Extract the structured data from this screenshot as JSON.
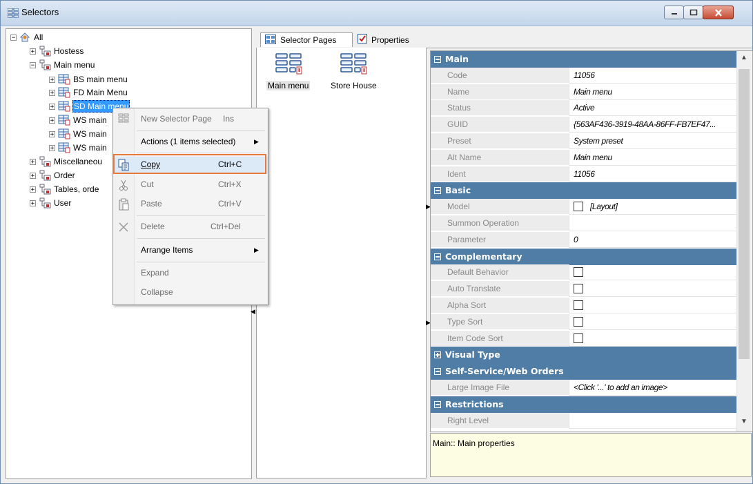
{
  "window": {
    "title": "Selectors"
  },
  "tree": {
    "root": "All",
    "items": [
      {
        "label": "Hostess",
        "expander": "+"
      },
      {
        "label": "Main menu",
        "expander": "−"
      },
      {
        "label": "BS main menu",
        "expander": "+"
      },
      {
        "label": "FD Main Menu",
        "expander": "+"
      },
      {
        "label": "SD Main menu",
        "expander": "+"
      },
      {
        "label": "WS main",
        "expander": "+"
      },
      {
        "label": "WS main",
        "expander": "+"
      },
      {
        "label": "WS main",
        "expander": "+"
      },
      {
        "label": "Miscellaneou",
        "expander": "+"
      },
      {
        "label": "Order",
        "expander": "+"
      },
      {
        "label": "Tables, orde",
        "expander": "+"
      },
      {
        "label": "User",
        "expander": "+"
      }
    ]
  },
  "tabs": {
    "selector_pages": "Selector Pages",
    "properties": "Properties"
  },
  "pages": [
    {
      "label": "Main menu"
    },
    {
      "label": "Store House"
    }
  ],
  "context_menu": {
    "new_selector_page": "New Selector Page",
    "new_selector_page_shortcut": "Ins",
    "actions": "Actions (1 items selected)",
    "copy": "Copy",
    "copy_shortcut": "Ctrl+C",
    "cut": "Cut",
    "cut_shortcut": "Ctrl+X",
    "paste": "Paste",
    "paste_shortcut": "Ctrl+V",
    "delete": "Delete",
    "delete_shortcut": "Ctrl+Del",
    "arrange": "Arrange Items",
    "expand": "Expand",
    "collapse": "Collapse"
  },
  "properties": {
    "main": "Main",
    "code": {
      "name": "Code",
      "value": "11056"
    },
    "pname": {
      "name": "Name",
      "value": "Main menu"
    },
    "status": {
      "name": "Status",
      "value": "Active"
    },
    "guid": {
      "name": "GUID",
      "value": "{563AF436-3919-48AA-86FF-FB7EF47..."
    },
    "preset": {
      "name": "Preset",
      "value": "System preset"
    },
    "alt_name": {
      "name": "Alt Name",
      "value": "Main menu"
    },
    "ident": {
      "name": "Ident",
      "value": "11056"
    },
    "basic": "Basic",
    "model": {
      "name": "Model",
      "value": "[Layout]"
    },
    "summon": {
      "name": "Summon Operation",
      "value": ""
    },
    "parameter": {
      "name": "Parameter",
      "value": "0"
    },
    "complementary": "Complementary",
    "default_behavior": {
      "name": "Default Behavior"
    },
    "auto_translate": {
      "name": "Auto Translate"
    },
    "alpha_sort": {
      "name": "Alpha Sort"
    },
    "type_sort": {
      "name": "Type Sort"
    },
    "item_code_sort": {
      "name": "Item Code Sort"
    },
    "visual_type": "Visual Type",
    "self_service": "Self-Service/Web Orders",
    "large_image": {
      "name": "Large Image File",
      "value": "<Click '...' to add an image>"
    },
    "restrictions": "Restrictions",
    "right_level": {
      "name": "Right Level",
      "value": ""
    }
  },
  "description": "Main:: Main properties"
}
